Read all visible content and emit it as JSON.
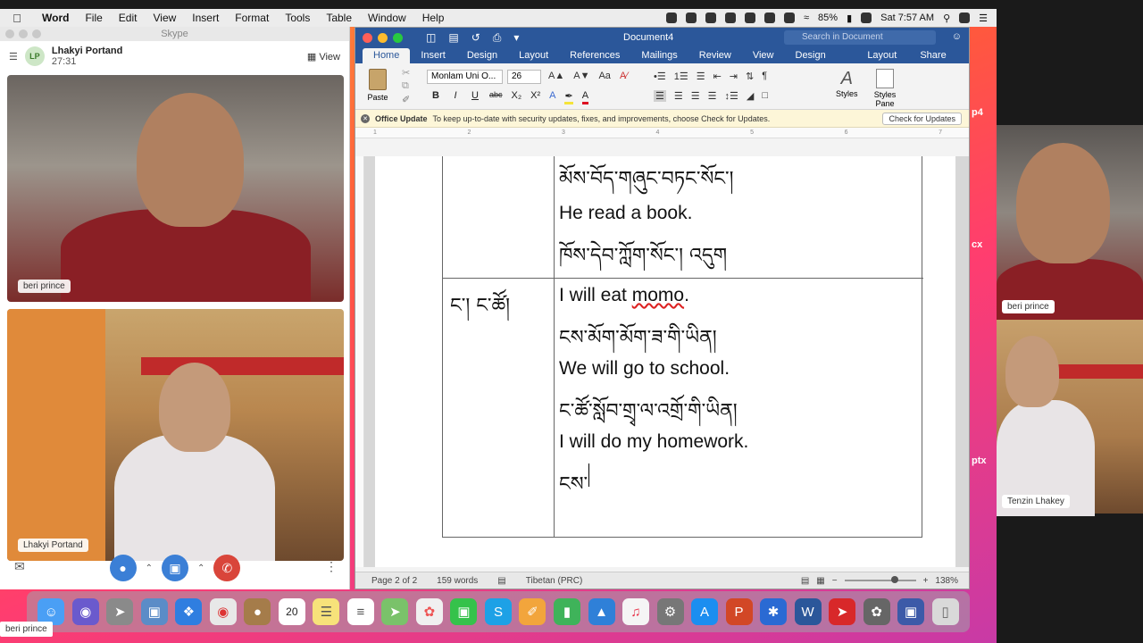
{
  "menubar": {
    "app": "Word",
    "items": [
      "File",
      "Edit",
      "View",
      "Insert",
      "Format",
      "Tools",
      "Table",
      "Window",
      "Help"
    ],
    "battery": "85%",
    "clock": "Sat 7:57 AM"
  },
  "skype": {
    "window_title": "Skype",
    "avatar_initials": "LP",
    "caller_name": "Lhakyi Portand",
    "call_time": "27:31",
    "view_label": "View",
    "video1_label": "beri prince",
    "video2_label": "Lhakyi Portand"
  },
  "word": {
    "doc_title": "Document4",
    "search_placeholder": "Search in Document",
    "tabs": [
      "Home",
      "Insert",
      "Design",
      "Layout",
      "References",
      "Mailings",
      "Review",
      "View",
      "Table Design",
      "Layout"
    ],
    "share_label": "Share",
    "paste_label": "Paste",
    "font_name": "Monlam Uni O...",
    "font_size": "26",
    "styles_label": "Styles",
    "styles_pane_label": "Styles Pane",
    "update_title": "Office Update",
    "update_text": "To keep up-to-date with security updates, fixes, and improvements, choose Check for Updates.",
    "update_button": "Check for Updates",
    "ruler_numbers": [
      "1",
      "2",
      "3",
      "4",
      "5",
      "6",
      "7"
    ],
    "status_page": "Page 2 of 2",
    "status_words": "159 words",
    "status_language": "Tibetan (PRC)",
    "zoom": "138%"
  },
  "document": {
    "row1_lines": [
      {
        "lang": "bo",
        "text": "མོས་བོད་གཞུང་བཏང་སོང་།"
      },
      {
        "lang": "en",
        "text": "He read a book."
      },
      {
        "lang": "bo",
        "text": "ཁོས་དེབ་ཀློག་སོང་། འདུག"
      }
    ],
    "row2_left": "ང་། ང་ཚོ།",
    "row2_lines": [
      {
        "lang": "en",
        "text": "I will eat momo.",
        "misspelled": "momo"
      },
      {
        "lang": "bo",
        "text": "ངས་མོག་མོག་ཟ་གི་ཡིན།"
      },
      {
        "lang": "en",
        "text": "We will go to school."
      },
      {
        "lang": "bo",
        "text": "ང་ཚོ་སློབ་གྲྭ་ལ་འགྲོ་གི་ཡིན།"
      },
      {
        "lang": "en",
        "text": "I will do my homework."
      },
      {
        "lang": "bo",
        "text": "ངས་"
      }
    ]
  },
  "right_videos": {
    "label1": "beri prince",
    "label2": "Tenzin Lhakey"
  },
  "side_fragments": [
    "p4",
    "cx",
    "ptx"
  ],
  "bottom_label": "beri prince",
  "dock_calendar_day": "20",
  "dock_apps": [
    "Finder",
    "Siri",
    "Launchpad",
    "Preview",
    "Safari",
    "Chrome",
    "Contacts",
    "Calendar",
    "Notes",
    "Reminders",
    "Maps",
    "Photos",
    "FaceTime",
    "Skype",
    "Pages",
    "Numbers",
    "Keynote",
    "Music",
    "System Preferences",
    "App Store",
    "PowerPoint",
    "Bluetooth",
    "Word",
    "Acrobat",
    "Photo Booth",
    "Screen",
    "Trash"
  ]
}
